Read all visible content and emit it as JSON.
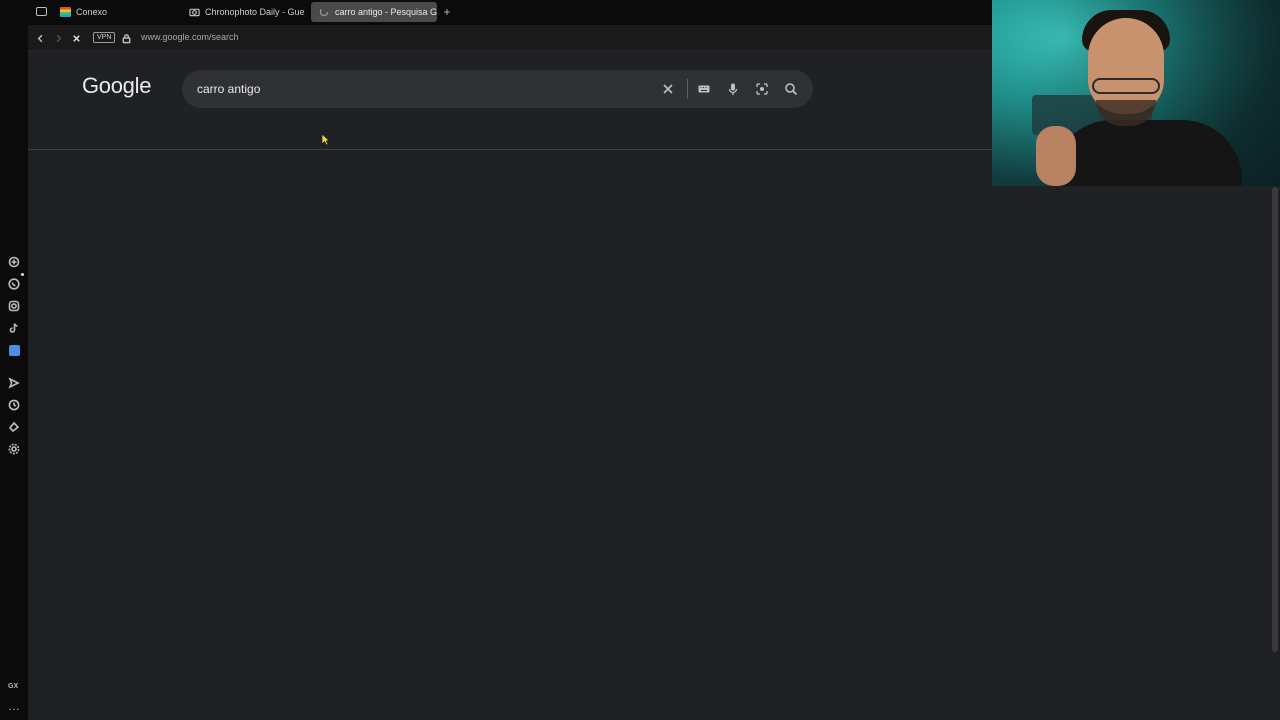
{
  "browser": {
    "tabs": [
      {
        "label": "Conexo",
        "icon": "grid-icon",
        "active": false
      },
      {
        "label": "Chronophoto Daily - Gues",
        "icon": "camera-icon",
        "active": false
      },
      {
        "label": "carro antigo - Pesquisa G",
        "icon": "loading-spinner-icon",
        "active": true
      }
    ],
    "new_tab_label": "+",
    "vpn_label": "VPN",
    "url": "www.google.com/search"
  },
  "sidebar": {
    "items": [
      "ai-icon",
      "whatsapp-icon",
      "instagram-icon",
      "tiktok-icon",
      "app-icon",
      "send-icon",
      "history-icon",
      "extensions-icon",
      "settings-icon"
    ],
    "brand_label": "GX",
    "more_label": "…"
  },
  "google": {
    "logo": "Google",
    "search_value": "carro antigo",
    "search_placeholder": "",
    "icons": [
      "clear-icon",
      "keyboard-icon",
      "mic-icon",
      "lens-icon",
      "search-icon"
    ]
  },
  "colors": {
    "page_bg": "#202124",
    "search_bg": "#303134",
    "active_tab_bg": "#4a4a4a"
  }
}
